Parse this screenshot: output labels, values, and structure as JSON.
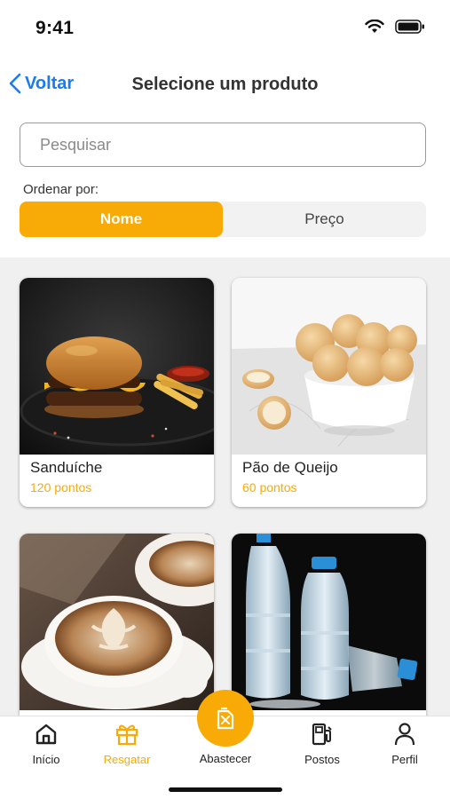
{
  "status": {
    "time": "9:41"
  },
  "nav": {
    "back_label": "Voltar",
    "title": "Selecione um produto"
  },
  "search": {
    "placeholder": "Pesquisar",
    "value": ""
  },
  "sort": {
    "label": "Ordenar por:",
    "options": [
      "Nome",
      "Preço"
    ],
    "selected": "Nome"
  },
  "products": [
    {
      "name": "Sanduíche",
      "points": "120 pontos",
      "image": "burger"
    },
    {
      "name": "Pão de Queijo",
      "points": "60 pontos",
      "image": "cheese-bread"
    },
    {
      "image": "cappuccino"
    },
    {
      "image": "water-bottles"
    }
  ],
  "tabbar": {
    "items": [
      {
        "label": "Início",
        "icon": "home-icon"
      },
      {
        "label": "Resgatar",
        "icon": "gift-icon",
        "active": true
      },
      {
        "label": "Abastecer",
        "icon": "fuel-can-icon"
      },
      {
        "label": "Postos",
        "icon": "gas-station-icon"
      },
      {
        "label": "Perfil",
        "icon": "user-icon"
      }
    ]
  },
  "colors": {
    "accent": "#f8ab06",
    "link": "#1a7cf0",
    "background": "#f0f0f0"
  }
}
